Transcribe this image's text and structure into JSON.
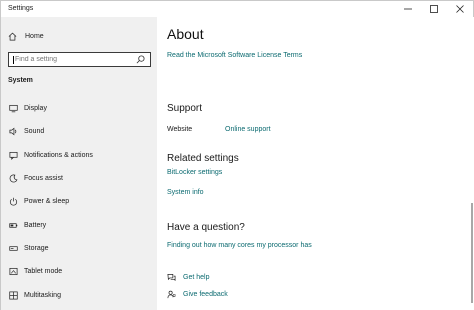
{
  "window": {
    "title": "Settings",
    "controls": [
      "minimize-icon",
      "maximize-icon",
      "close-icon"
    ]
  },
  "sidebar": {
    "home_label": "Home",
    "search": {
      "placeholder": "Find a setting",
      "value": ""
    },
    "section_title": "System",
    "items": [
      {
        "label": "Display",
        "icon": "display-icon"
      },
      {
        "label": "Sound",
        "icon": "sound-icon"
      },
      {
        "label": "Notifications & actions",
        "icon": "notifications-icon"
      },
      {
        "label": "Focus assist",
        "icon": "focus-assist-icon"
      },
      {
        "label": "Power & sleep",
        "icon": "power-icon"
      },
      {
        "label": "Battery",
        "icon": "battery-icon"
      },
      {
        "label": "Storage",
        "icon": "storage-icon"
      },
      {
        "label": "Tablet mode",
        "icon": "tablet-mode-icon"
      },
      {
        "label": "Multitasking",
        "icon": "multitasking-icon"
      }
    ]
  },
  "main": {
    "title": "About",
    "license_link": "Read the Microsoft Software License Terms",
    "support": {
      "heading": "Support",
      "website_label": "Website",
      "website_link": "Online support"
    },
    "related": {
      "heading": "Related settings",
      "links": [
        "BitLocker settings",
        "System info"
      ]
    },
    "question": {
      "heading": "Have a question?",
      "link": "Finding out how many cores my processor has"
    },
    "help_link": "Get help",
    "feedback_link": "Give feedback"
  },
  "colors": {
    "link": "#0b6a70",
    "sidebar_bg": "#f0f0f0",
    "content_bg": "#ffffff"
  }
}
